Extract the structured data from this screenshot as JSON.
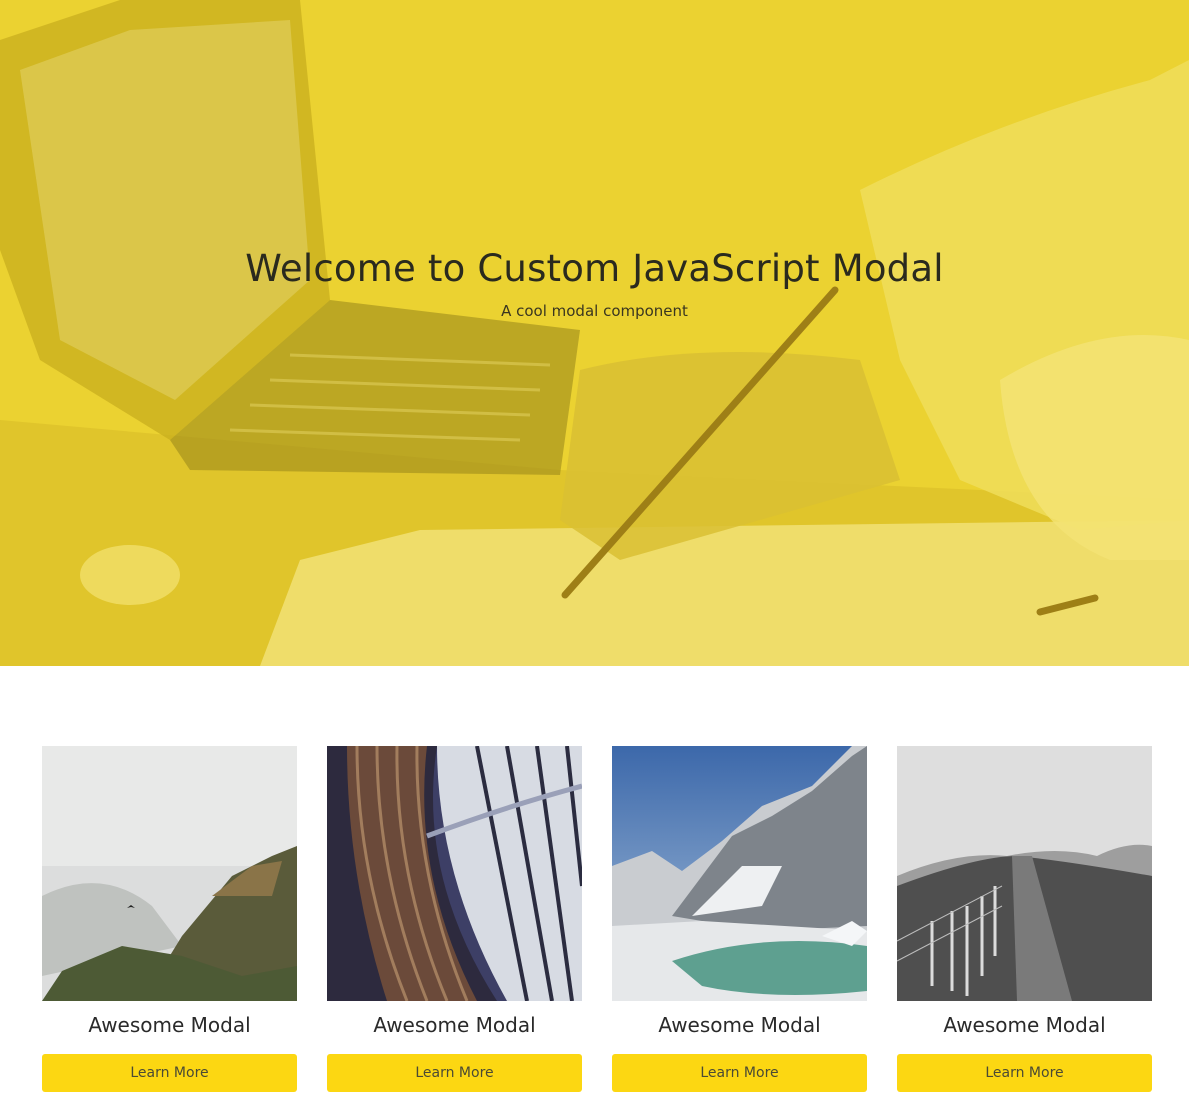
{
  "hero": {
    "title": "Welcome to Custom JavaScript Modal",
    "subtitle": "A cool modal component"
  },
  "cards": [
    {
      "title": "Awesome Modal",
      "button_label": "Learn More",
      "image": "misty-mountain-photo"
    },
    {
      "title": "Awesome Modal",
      "button_label": "Learn More",
      "image": "library-bookshelves-photo"
    },
    {
      "title": "Awesome Modal",
      "button_label": "Learn More",
      "image": "snowy-peaks-lake-photo"
    },
    {
      "title": "Awesome Modal",
      "button_label": "Learn More",
      "image": "grayscale-hill-fence-photo"
    }
  ],
  "colors": {
    "hero_overlay": "#e9cf2a",
    "button_bg": "#fcd712",
    "text_dark": "#2a2a2a"
  }
}
